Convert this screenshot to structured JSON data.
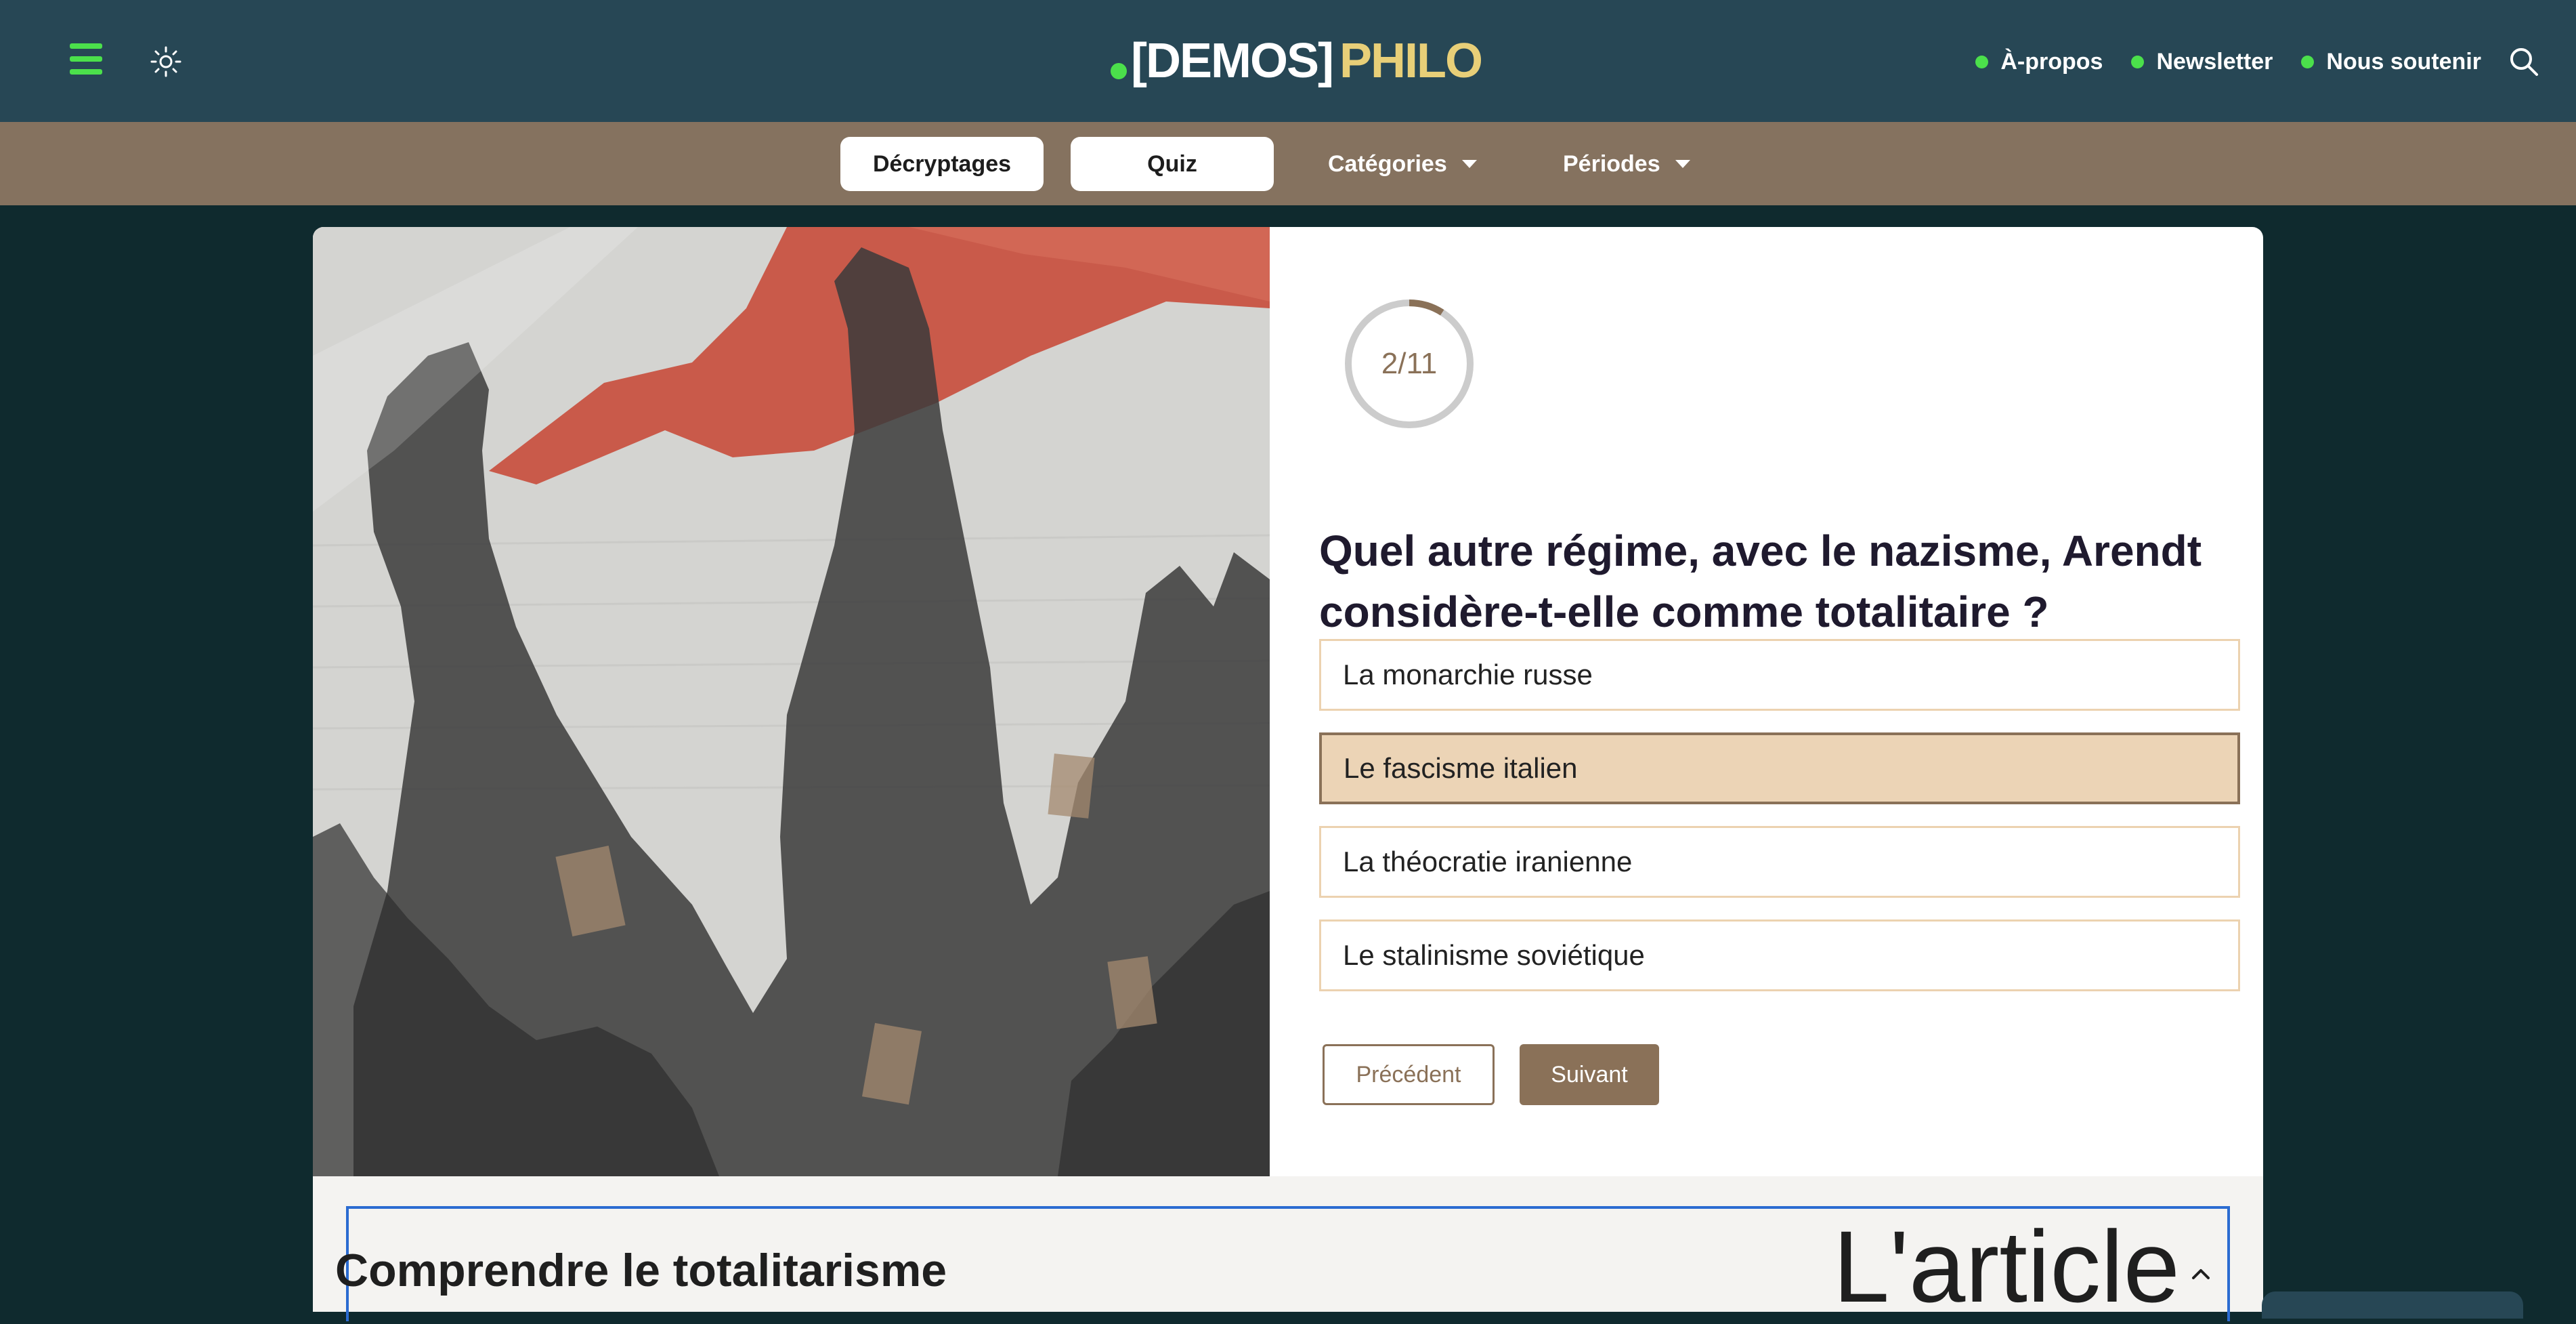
{
  "header": {
    "logo": {
      "part1": "[DEMOS]",
      "part2": "PHILO"
    },
    "nav": [
      {
        "label": "À-propos"
      },
      {
        "label": "Newsletter"
      },
      {
        "label": "Nous soutenir"
      }
    ],
    "icons": {
      "menu": "hamburger-icon",
      "theme": "sun-icon",
      "search": "search-icon"
    }
  },
  "subnav": {
    "tabs": [
      {
        "label": "Décryptages"
      },
      {
        "label": "Quiz"
      }
    ],
    "dropdowns": [
      {
        "label": "Catégories"
      },
      {
        "label": "Périodes"
      }
    ]
  },
  "quiz": {
    "progress": {
      "label": "2/11",
      "current": 2,
      "total": 11
    },
    "question": "Quel autre régime, avec le nazisme, Arendt considère-t-elle comme totalitaire ?",
    "answers": [
      {
        "label": "La monarchie russe",
        "selected": false
      },
      {
        "label": "Le fascisme italien",
        "selected": true
      },
      {
        "label": "La théocratie iranienne",
        "selected": false
      },
      {
        "label": "Le stalinisme soviétique",
        "selected": false
      }
    ],
    "prev_label": "Précédent",
    "next_label": "Suivant"
  },
  "article": {
    "title": "Comprendre le totalitarisme",
    "label": "L'article"
  },
  "colors": {
    "header_bg": "#274755",
    "subnav_bg": "#85725f",
    "accent_green": "#4be04b",
    "accent_brown": "#8a7158",
    "logo_gold": "#e8cf78",
    "selected_bg": "#ecd4b6",
    "page_bg": "#0f2a2e"
  }
}
